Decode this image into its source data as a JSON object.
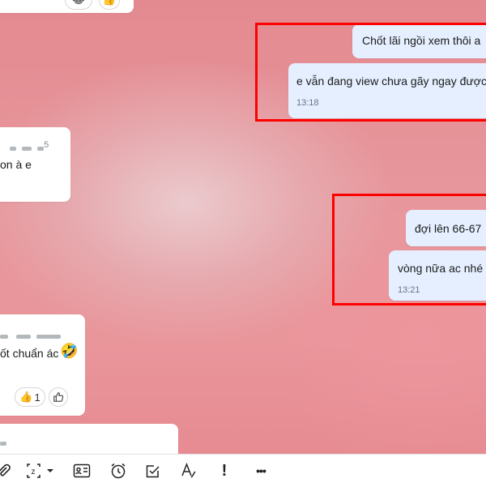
{
  "messages": {
    "top_left": {
      "reactions": [
        "😂",
        "👍"
      ]
    },
    "out1": {
      "text": "Chốt lãi ngồi xem thôi a"
    },
    "out2": {
      "text": "e vẫn đang view chưa gãy ngay được",
      "time": "13:18"
    },
    "in1": {
      "sender_tail": "5",
      "text": "on à e"
    },
    "out3": {
      "text": "đợi lên 66-67"
    },
    "out4": {
      "text": "vòng nữa ac nhé",
      "time": "13:21"
    },
    "in2": {
      "text": "ốt chuẩn ác",
      "emoji": "🤣",
      "reaction_emoji": "👍",
      "reaction_count": "1"
    }
  },
  "toolbar": {
    "icons": [
      "attach-icon",
      "zoom-capture-icon",
      "contact-card-icon",
      "alarm-icon",
      "task-check-icon",
      "text-format-icon",
      "important-icon",
      "more-icon"
    ],
    "important_glyph": "!",
    "more_glyph": "•••"
  },
  "colors": {
    "outgoing_bubble": "#e5efff",
    "incoming_bubble": "#ffffff",
    "highlight_box": "#ff0000"
  }
}
